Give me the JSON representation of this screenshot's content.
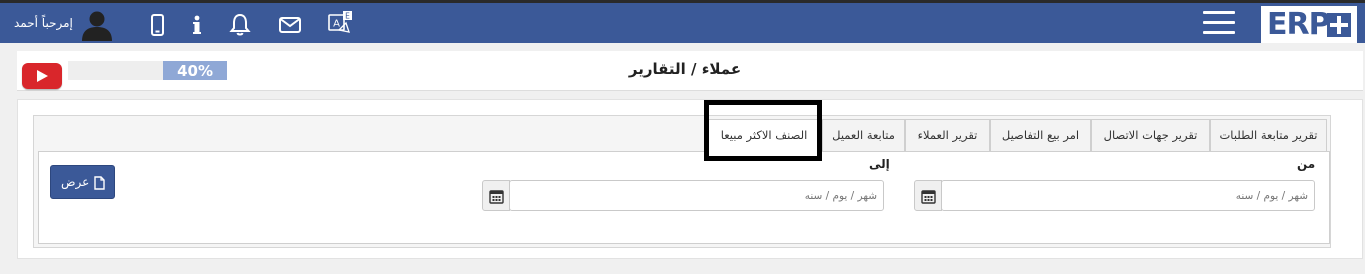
{
  "header": {
    "logo_text": "ERP",
    "welcome": "إمرحباً أحمد",
    "translate_badge": "E"
  },
  "toolbar": {
    "progress_percent": 40,
    "progress_label": "40%",
    "page_title": "عملاء / التقارير"
  },
  "tabs": [
    {
      "label": "تقرير متابعة الطلبات",
      "active": false
    },
    {
      "label": "تقرير جهات الاتصال",
      "active": false
    },
    {
      "label": "امر بيع التفاصيل",
      "active": false
    },
    {
      "label": "تقرير العملاء",
      "active": false
    },
    {
      "label": "متابعة العميل",
      "active": false
    },
    {
      "label": "الصنف الاكثر مبيعا",
      "active": true
    }
  ],
  "form": {
    "from_label": "من",
    "to_label": "إلى",
    "from_placeholder": "شهر / يوم / سنه",
    "to_placeholder": "شهر / يوم / سنه",
    "show_button": "عرض"
  },
  "colors": {
    "brand": "#3b5998",
    "youtube": "#d9262b",
    "progress": "#8fa8d6"
  }
}
